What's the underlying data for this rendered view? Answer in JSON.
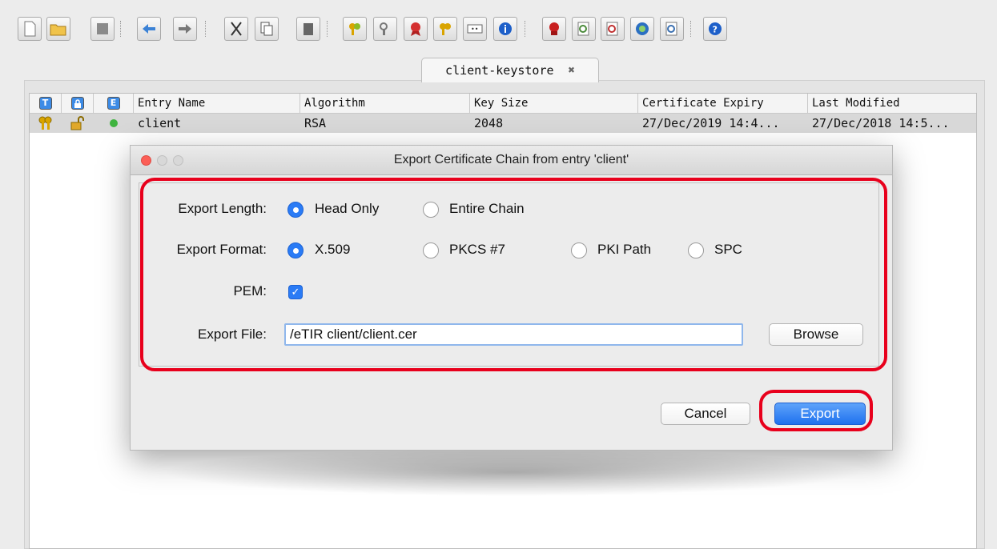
{
  "toolbar": {
    "buttons": [
      "new-keystore-icon",
      "open-keystore-icon",
      "save-keystore-icon",
      "undo-icon",
      "redo-icon",
      "cut-icon",
      "copy-icon",
      "paste-icon",
      "generate-keypair-icon",
      "generate-secret-key-icon",
      "import-trusted-cert-icon",
      "import-keypair-icon",
      "set-password-icon",
      "properties-icon",
      "examine-file-icon",
      "examine-clipboard-icon",
      "examine-ssl-icon",
      "examine-csr-icon",
      "examine-crl-icon",
      "help-icon"
    ]
  },
  "tab": {
    "label": "client-keystore",
    "close": "✖"
  },
  "table": {
    "icon_headers": [
      "T",
      "🔒",
      "E"
    ],
    "columns": [
      "Entry Name",
      "Algorithm",
      "Key Size",
      "Certificate Expiry",
      "Last Modified"
    ],
    "rows": [
      {
        "name": "client",
        "algorithm": "RSA",
        "key_size": "2048",
        "expiry": "27/Dec/2019 14:4...",
        "modified": "27/Dec/2018 14:5..."
      }
    ]
  },
  "dialog": {
    "title": "Export Certificate Chain from entry 'client'",
    "export_length_label": "Export Length:",
    "length_options": [
      "Head Only",
      "Entire Chain"
    ],
    "selected_length": "Head Only",
    "export_format_label": "Export Format:",
    "format_options": [
      "X.509",
      "PKCS #7",
      "PKI Path",
      "SPC"
    ],
    "selected_format": "X.509",
    "pem_label": "PEM:",
    "pem_checked": true,
    "export_file_label": "Export File:",
    "export_file_value": "/eTIR client/client.cer",
    "browse_label": "Browse",
    "cancel_label": "Cancel",
    "export_label": "Export"
  },
  "colors": {
    "accent": "#2a7bf5",
    "highlight": "#e8001c"
  }
}
